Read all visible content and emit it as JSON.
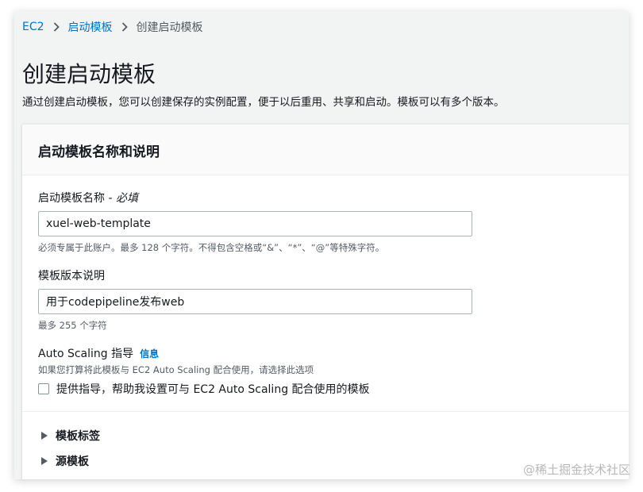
{
  "breadcrumb": {
    "items": [
      "EC2",
      "启动模板"
    ],
    "current": "创建启动模板"
  },
  "page": {
    "title": "创建启动模板",
    "description": "通过创建启动模板，您可以创建保存的实例配置，便于以后重用、共享和启动。模板可以有多个版本。"
  },
  "panel": {
    "title": "启动模板名称和说明",
    "name_field": {
      "label": "启动模板名称 - ",
      "label_suffix": "必填",
      "value": "xuel-web-template",
      "hint": "必须专属于此账户。最多 128 个字符。不得包含空格或“&”、“*”、“@”等特殊字符。"
    },
    "desc_field": {
      "label": "模板版本说明",
      "value": "用于codepipeline发布web",
      "hint": "最多 255 个字符"
    },
    "autoscaling": {
      "label": "Auto Scaling 指导",
      "info": "信息",
      "hint": "如果您打算将此模板与 EC2 Auto Scaling 配合使用，请选择此选项",
      "checkbox_label": "提供指导，帮助我设置可与 EC2 Auto Scaling 配合使用的模板",
      "checked": false
    },
    "expanders": [
      "模板标签",
      "源模板"
    ]
  },
  "watermark": "@稀土掘金技术社区",
  "colors": {
    "link": "#0073bb",
    "text": "#16191f",
    "muted": "#545b64",
    "background": "#f2f3f3"
  }
}
